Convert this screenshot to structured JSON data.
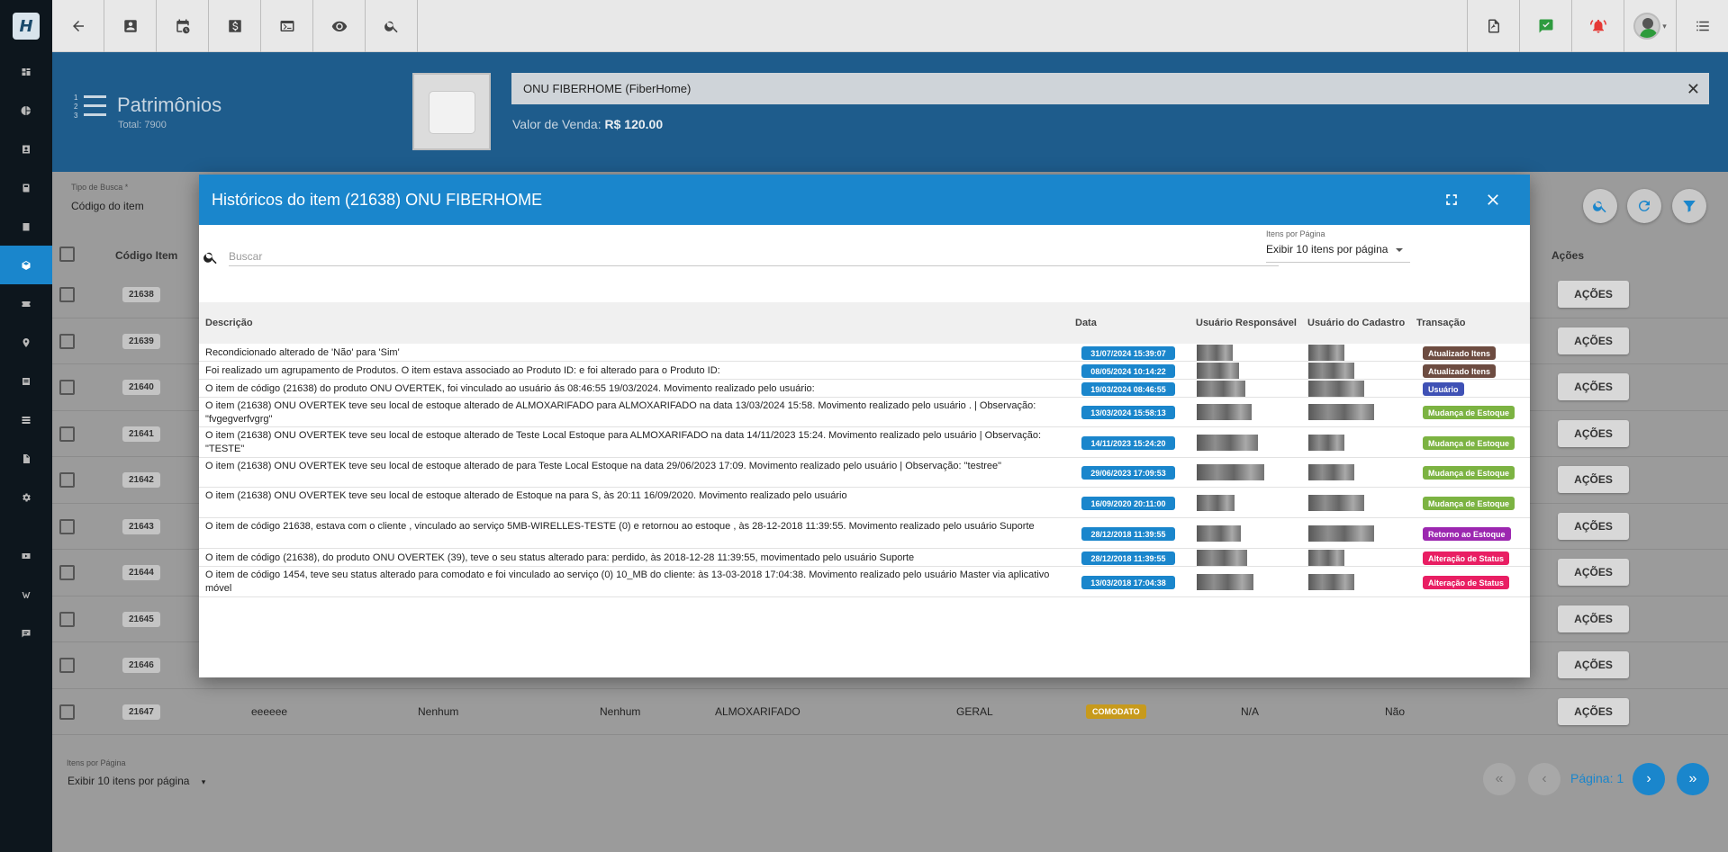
{
  "colors": {
    "accent": "#1a86cc",
    "sidebar_bg": "#0d161d",
    "header_band": "#1e5c8c",
    "tx_atualizado": "#6d4c41",
    "tx_usuario": "#3f51b5",
    "tx_mudanca": "#7cb342",
    "tx_retorno": "#9c27b0",
    "tx_status": "#e91e63",
    "comodato": "#c79a1c"
  },
  "sidebar": {
    "logo_text": "H",
    "items": [
      {
        "icon": "dashboard-icon"
      },
      {
        "icon": "pie-chart-icon"
      },
      {
        "icon": "contacts-icon"
      },
      {
        "icon": "book-icon"
      },
      {
        "icon": "calendar-icon"
      },
      {
        "icon": "package-icon",
        "active": true
      },
      {
        "icon": "ticket-icon"
      },
      {
        "icon": "map-pin-icon"
      },
      {
        "icon": "list-icon"
      },
      {
        "icon": "server-icon"
      },
      {
        "icon": "document-icon"
      },
      {
        "icon": "settings-icon"
      },
      {
        "icon": "video-icon"
      },
      {
        "icon": "wordpress-icon"
      },
      {
        "icon": "chat-icon"
      }
    ]
  },
  "topbar": {
    "left_icons": [
      "back-icon",
      "contact-card-icon",
      "calendar-clock-icon",
      "dollar-icon",
      "terminal-icon",
      "eye-icon",
      "search-icon"
    ],
    "right_icons": [
      "pdf-icon",
      "task-check-icon",
      "alarm-icon",
      "user-avatar-icon",
      "menu-icon"
    ]
  },
  "header": {
    "title": "Patrimônios",
    "total": "Total: 7900",
    "product_name": "ONU FIBERHOME  (FiberHome)",
    "price_label": "Valor de Venda:",
    "price_value": "R$ 120.00"
  },
  "filter": {
    "label": "Tipo de Busca *",
    "value": "Código do item"
  },
  "bg_table": {
    "headers": {
      "code": "Código Item",
      "actions": "Ações"
    },
    "action_label": "AÇÕES",
    "rows": [
      {
        "code": "21638"
      },
      {
        "code": "21639"
      },
      {
        "code": "21640"
      },
      {
        "code": "21641"
      },
      {
        "code": "21642"
      },
      {
        "code": "21643"
      },
      {
        "code": "21644"
      },
      {
        "code": "21645"
      },
      {
        "code": "21646"
      },
      {
        "code": "21647",
        "desc": "eeeeee",
        "c1": "Nenhum",
        "c2": "Nenhum",
        "local": "ALMOXARIFADO",
        "type": "GERAL",
        "status": "COMODATO",
        "user": "N/A",
        "flag": "Não"
      }
    ]
  },
  "pagination": {
    "label": "Itens por Página",
    "select": "Exibir 10 itens por página",
    "page_text": "Página: 1"
  },
  "modal": {
    "title": "Históricos do item (21638) ONU FIBERHOME",
    "search_placeholder": "Buscar",
    "ipp_label": "Itens por Página",
    "ipp_value": "Exibir 10 itens por página",
    "columns": {
      "descricao": "Descrição",
      "data": "Data",
      "usuario_resp": "Usuário Responsável",
      "usuario_cad": "Usuário do Cadastro",
      "transacao": "Transação"
    },
    "rows": [
      {
        "desc": "Recondicionado alterado de 'Não' para 'Sim'",
        "date": "31/07/2024 15:39:07",
        "tx": "Atualizado Itens",
        "tx_color": "#6d4c41"
      },
      {
        "desc": "Foi realizado um agrupamento de Produtos. O item estava associado ao Produto ID:     e foi alterado para o Produto ID:",
        "date": "08/05/2024 10:14:22",
        "tx": "Atualizado Itens",
        "tx_color": "#6d4c41"
      },
      {
        "desc": "O item de código (21638) do produto ONU OVERTEK, foi vinculado ao usuário               ás 08:46:55 19/03/2024. Movimento realizado pelo usuário:",
        "date": "19/03/2024 08:46:55",
        "tx": "Usuário",
        "tx_color": "#3f51b5"
      },
      {
        "desc": "O item (21638) ONU OVERTEK teve seu local de estoque alterado de ALMOXARIFADO para ALMOXARIFADO na data 13/03/2024 15:58. Movimento realizado pelo usuário            . | Observação: \"fvgegverfvgrg\"",
        "date": "13/03/2024 15:58:13",
        "tx": "Mudança de Estoque",
        "tx_color": "#7cb342"
      },
      {
        "desc": "O item (21638) ONU OVERTEK teve seu local de estoque alterado de Teste Local Estoque para ALMOXARIFADO na data 14/11/2023 15:24. Movimento realizado pelo usuário         | Observação: \"TESTE\"",
        "date": "14/11/2023 15:24:20",
        "tx": "Mudança de Estoque",
        "tx_color": "#7cb342"
      },
      {
        "desc": "O item (21638) ONU OVERTEK teve seu local de estoque alterado de                                    para Teste Local Estoque na data 29/06/2023 17:09. Movimento realizado pelo usuário              | Observação: \"testree\"",
        "date": "29/06/2023 17:09:53",
        "tx": "Mudança de Estoque",
        "tx_color": "#7cb342"
      },
      {
        "desc": "O item (21638) ONU OVERTEK teve seu local de estoque alterado de Estoque na                    para                               S, às 20:11 16/09/2020. Movimento realizado pelo usuário",
        "date": "16/09/2020 20:11:00",
        "tx": "Mudança de Estoque",
        "tx_color": "#7cb342"
      },
      {
        "desc": "O item de código 21638, estava com o cliente                                                      , vinculado ao serviço 5MB-WIRELLES-TESTE (0) e retornou ao estoque , às 28-12-2018 11:39:55. Movimento realizado pelo usuário Suporte",
        "date": "28/12/2018 11:39:55",
        "tx": "Retorno ao Estoque",
        "tx_color": "#9c27b0"
      },
      {
        "desc": "O item de código (21638), do produto ONU OVERTEK (39), teve o seu status alterado para: perdido, às 2018-12-28 11:39:55, movimentado pelo usuário Suporte",
        "date": "28/12/2018 11:39:55",
        "tx": "Alteração de Status",
        "tx_color": "#e91e63"
      },
      {
        "desc": "O item de código 1454, teve seu status alterado para comodato e foi vinculado ao serviço (0) 10_MB do cliente:                                                           às 13-03-2018 17:04:38. Movimento realizado pelo usuário Master via aplicativo móvel",
        "date": "13/03/2018 17:04:38",
        "tx": "Alteração de Status",
        "tx_color": "#e91e63"
      }
    ]
  }
}
